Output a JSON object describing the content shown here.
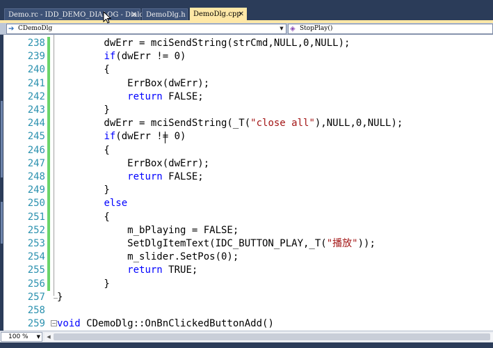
{
  "tabs": [
    {
      "label": "Demo.rc - IDD_DEMO_DIALOG - Dialog",
      "active": false
    },
    {
      "label": "DemoDlg.h",
      "active": false
    },
    {
      "label": "DemoDlg.cpp",
      "active": true
    }
  ],
  "navigation": {
    "class_combo": "CDemoDlg",
    "member_combo": "StopPlay()"
  },
  "editor": {
    "lines": [
      {
        "num": "238",
        "segs": [
          {
            "t": "        dwErr = mciSendString(strCmd,NULL,0,NULL);",
            "c": ""
          }
        ]
      },
      {
        "num": "239",
        "segs": [
          {
            "t": "        ",
            "c": ""
          },
          {
            "t": "if",
            "c": "kw"
          },
          {
            "t": "(dwErr != 0)",
            "c": ""
          }
        ]
      },
      {
        "num": "240",
        "segs": [
          {
            "t": "        {",
            "c": ""
          }
        ]
      },
      {
        "num": "241",
        "segs": [
          {
            "t": "            ErrBox(dwErr);",
            "c": ""
          }
        ]
      },
      {
        "num": "242",
        "segs": [
          {
            "t": "            ",
            "c": ""
          },
          {
            "t": "return",
            "c": "kw"
          },
          {
            "t": " FALSE;",
            "c": ""
          }
        ]
      },
      {
        "num": "243",
        "segs": [
          {
            "t": "        }",
            "c": ""
          }
        ]
      },
      {
        "num": "244",
        "segs": [
          {
            "t": "        dwErr = mciSendString(_T(",
            "c": ""
          },
          {
            "t": "\"close all\"",
            "c": "str"
          },
          {
            "t": "),NULL,0,NULL);",
            "c": ""
          }
        ]
      },
      {
        "num": "245",
        "segs": [
          {
            "t": "        ",
            "c": ""
          },
          {
            "t": "if",
            "c": "kw"
          },
          {
            "t": "(dwErr != 0)",
            "c": ""
          }
        ]
      },
      {
        "num": "246",
        "segs": [
          {
            "t": "        {",
            "c": ""
          }
        ]
      },
      {
        "num": "247",
        "segs": [
          {
            "t": "            ErrBox(dwErr);",
            "c": ""
          }
        ]
      },
      {
        "num": "248",
        "segs": [
          {
            "t": "            ",
            "c": ""
          },
          {
            "t": "return",
            "c": "kw"
          },
          {
            "t": " FALSE;",
            "c": ""
          }
        ]
      },
      {
        "num": "249",
        "segs": [
          {
            "t": "        }",
            "c": ""
          }
        ]
      },
      {
        "num": "250",
        "segs": [
          {
            "t": "        ",
            "c": ""
          },
          {
            "t": "else",
            "c": "kw"
          }
        ]
      },
      {
        "num": "251",
        "segs": [
          {
            "t": "        {",
            "c": ""
          }
        ]
      },
      {
        "num": "252",
        "segs": [
          {
            "t": "            m_bPlaying = FALSE;",
            "c": ""
          }
        ]
      },
      {
        "num": "253",
        "segs": [
          {
            "t": "            SetDlgItemText(IDC_BUTTON_PLAY,_T(",
            "c": ""
          },
          {
            "t": "\"播放\"",
            "c": "str"
          },
          {
            "t": "));",
            "c": ""
          }
        ]
      },
      {
        "num": "254",
        "segs": [
          {
            "t": "            m_slider.SetPos(0);",
            "c": ""
          }
        ]
      },
      {
        "num": "255",
        "segs": [
          {
            "t": "            ",
            "c": ""
          },
          {
            "t": "return",
            "c": "kw"
          },
          {
            "t": " TRUE;",
            "c": ""
          }
        ]
      },
      {
        "num": "256",
        "segs": [
          {
            "t": "        }",
            "c": ""
          }
        ]
      },
      {
        "num": "257",
        "segs": [
          {
            "t": "}",
            "c": ""
          }
        ]
      },
      {
        "num": "258",
        "segs": []
      },
      {
        "num": "259",
        "segs": [
          {
            "t": "void",
            "c": "kw"
          },
          {
            "t": " CDemoDlg::OnBnClickedButtonAdd()",
            "c": ""
          }
        ]
      }
    ]
  },
  "status": {
    "zoom": "100 %"
  },
  "colors": {
    "keyword": "#0000ff",
    "string": "#a31515",
    "line_number": "#2b91af",
    "changed_line_marker": "#6bd46b",
    "active_tab": "#ffe8a6",
    "frame": "#2b3c59"
  }
}
